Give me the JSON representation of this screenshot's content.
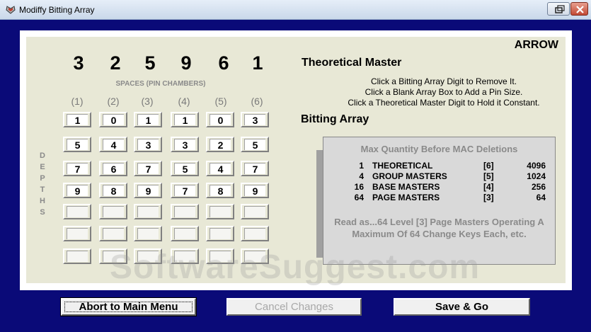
{
  "window": {
    "title": "Modiffy Bitting Array"
  },
  "header": {
    "mode_label": "ARROW"
  },
  "master": {
    "digits": [
      "3",
      "2",
      "5",
      "9",
      "6",
      "1"
    ],
    "spaces_label": "SPACES (PIN CHAMBERS)",
    "column_labels": [
      "(1)",
      "(2)",
      "(3)",
      "(4)",
      "(5)",
      "(6)"
    ]
  },
  "array": {
    "depths_label": [
      "D",
      "E",
      "P",
      "T",
      "H",
      "S"
    ],
    "rows": [
      [
        "1",
        "0",
        "1",
        "1",
        "0",
        "3"
      ],
      [
        "5",
        "4",
        "3",
        "3",
        "2",
        "5"
      ],
      [
        "7",
        "6",
        "7",
        "5",
        "4",
        "7"
      ],
      [
        "9",
        "8",
        "9",
        "7",
        "8",
        "9"
      ],
      [
        "",
        "",
        "",
        "",
        "",
        ""
      ],
      [
        "",
        "",
        "",
        "",
        "",
        ""
      ],
      [
        "",
        "",
        "",
        "",
        "",
        ""
      ]
    ]
  },
  "theoretical_master": {
    "title": "Theoretical Master",
    "instructions": [
      "Click a Bitting Array Digit to Remove It.",
      "Click a Blank Array Box to Add a Pin Size.",
      "Click a Theoretical Master Digit to Hold it Constant."
    ]
  },
  "bitting_array": {
    "title": "Bitting Array"
  },
  "info_box": {
    "heading": "Max Quantity Before MAC Deletions",
    "rows": [
      {
        "count": "1",
        "name": "THEORETICAL",
        "level": "[6]",
        "max": "4096"
      },
      {
        "count": "4",
        "name": "GROUP MASTERS",
        "level": "[5]",
        "max": "1024"
      },
      {
        "count": "16",
        "name": "BASE MASTERS",
        "level": "[4]",
        "max": "256"
      },
      {
        "count": "64",
        "name": "PAGE MASTERS",
        "level": "[3]",
        "max": "64"
      }
    ],
    "note_line1": "Read as...64 Level [3] Page Masters Operating A",
    "note_line2": "Maximum Of 64 Change Keys Each, etc."
  },
  "watermark": "SoftwareSuggest.com",
  "buttons": {
    "abort": "Abort to Main Menu",
    "cancel": "Cancel Changes",
    "save": "Save & Go"
  }
}
